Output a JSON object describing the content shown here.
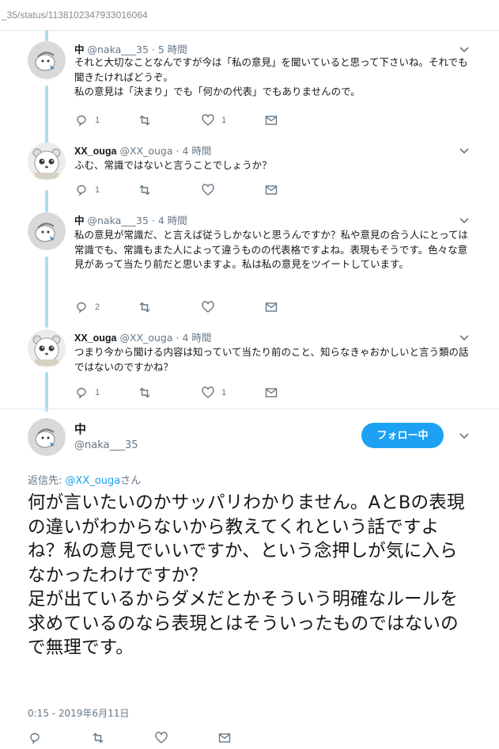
{
  "browser": {
    "url": "_35/status/1138102347933016064"
  },
  "colors": {
    "accent": "#1da1f2",
    "thread_line": "#a9dcf7",
    "muted": "#657786"
  },
  "replies": [
    {
      "name": "中",
      "handle": "@naka___35",
      "sep": "·",
      "time": "5 時間",
      "avatar": "naka-avatar",
      "text": "それと大切なことなんですが今は「私の意見」を聞いていると思って下さいね。それでも聞きたければどうぞ。\n私の意見は「決まり」でも「何かの代表」でもありませんので。",
      "reply_count": "1",
      "retweet_count": "",
      "like_count": "1"
    },
    {
      "name": "XX_ouga",
      "handle": "@XX_ouga",
      "sep": "·",
      "time": "4 時間",
      "avatar": "ouga-avatar",
      "text": "ふむ、常識ではないと言うことでしょうか？",
      "reply_count": "1",
      "retweet_count": "",
      "like_count": ""
    },
    {
      "name": "中",
      "handle": "@naka___35",
      "sep": "·",
      "time": "4 時間",
      "avatar": "naka-avatar",
      "text": "私の意見が常識だ、と言えば従うしかないと思うんですか？私や意見の合う人にとっては常識でも、常識もまた人によって違うものの代表格ですよね。表現もそうです。色々な意見があって当たり前だと思いますよ。私は私の意見をツイートしています。",
      "reply_count": "2",
      "retweet_count": "",
      "like_count": ""
    },
    {
      "name": "XX_ouga",
      "handle": "@XX_ouga",
      "sep": "·",
      "time": "4 時間",
      "avatar": "ouga-avatar",
      "text": "つまり今から聞ける内容は知っていて当たり前のこと、知らなきゃおかしいと言う類の話ではないのですかね？",
      "reply_count": "1",
      "retweet_count": "",
      "like_count": "1"
    }
  ],
  "main_tweet": {
    "name": "中",
    "handle": "@naka___35",
    "follow_label": "フォロー中",
    "reply_to_prefix": "返信先: ",
    "reply_to_user": "@XX_ouga",
    "reply_to_suffix": "さん",
    "text": "何が言いたいのかサッパリわかりません。AとBの表現の違いがわからないから教えてくれという話ですよね？私の意見でいいですか、という念押しが気に入らなかったわけですか？\n足が出ているからダメだとかそういう明確なルールを求めているのなら表現とはそういったものではないので無理です。",
    "date": "0:15 - 2019年6月11日"
  }
}
